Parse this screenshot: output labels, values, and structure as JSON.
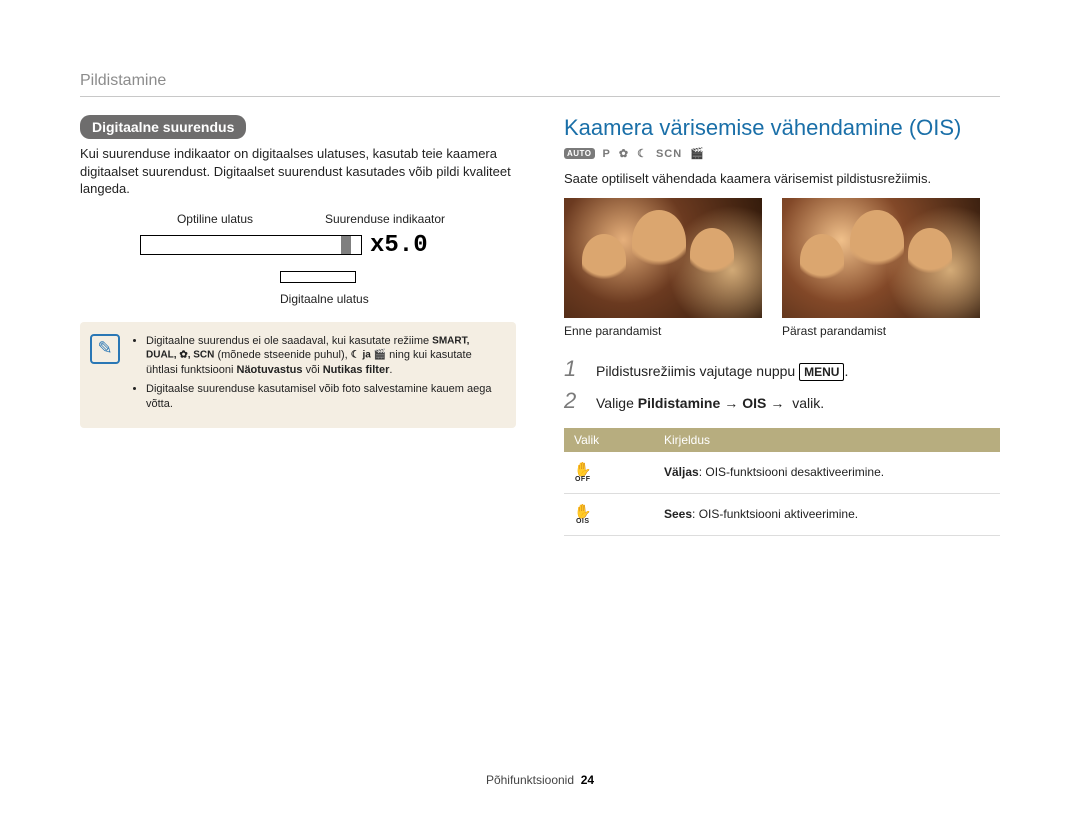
{
  "breadcrumb": "Pildistamine",
  "left": {
    "pill": "Digitaalne suurendus",
    "intro": "Kui suurenduse indikaator on digitaalses ulatuses, kasutab teie kaamera digitaalset suurendust. Digitaalset suurendust kasutades võib pildi kvaliteet langeda.",
    "zoom": {
      "optical_label": "Optiline ulatus",
      "indicator_label": "Suurenduse indikaator",
      "digital_label": "Digitaalne ulatus",
      "value": "x5.0"
    },
    "note": {
      "b1_pre": "Digitaalne suurendus ei ole saadaval, kui kasutate režiime ",
      "b1_icons": "SMART, DUAL, ✿, SCN",
      "b1_mid": " (mõnede stseenide puhul), ",
      "b1_icons2": "☾ ja 🎬",
      "b1_post1": " ning kui kasutate ühtlasi funktsiooni ",
      "b1_bold1": "Näotuvastus",
      "b1_or": " või ",
      "b1_bold2": "Nutikas filter",
      "b2": "Digitaalse suurenduse kasutamisel võib foto salvestamine kauem aega võtta."
    }
  },
  "right": {
    "heading": "Kaamera värisemise vähendamine (OIS)",
    "modes": {
      "auto": "AUTO",
      "p": "P",
      "flower": "✿",
      "moon": "☾",
      "scn": "SCN",
      "movie": "🎬"
    },
    "intro": "Saate optiliselt vähendada kaamera värisemist pildistusrežiimis.",
    "caption_before": "Enne parandamist",
    "caption_after": "Pärast parandamist",
    "step1_pre": "Pildistusrežiimis vajutage nuppu ",
    "step1_btn": "MENU",
    "step2_pre": "Valige ",
    "step2_b1": "Pildistamine",
    "step2_b2": "OIS",
    "step2_post": " valik.",
    "table": {
      "h1": "Valik",
      "h2": "Kirjeldus",
      "r1_sub": "OFF",
      "r1_b": "Väljas",
      "r1_t": ": OIS-funktsiooni desaktiveerimine.",
      "r2_sub": "OIS",
      "r2_b": "Sees",
      "r2_t": ": OIS-funktsiooni aktiveerimine."
    }
  },
  "footer": {
    "section": "Põhifunktsioonid",
    "page": "24"
  }
}
